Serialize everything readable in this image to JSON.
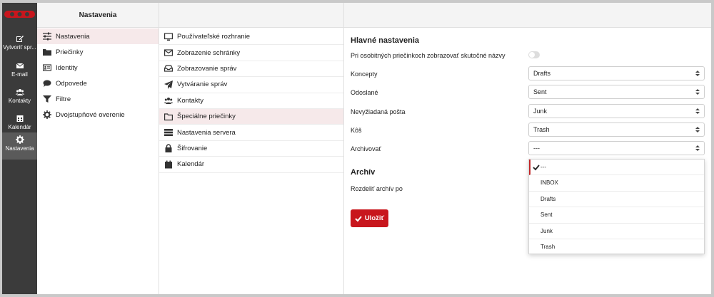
{
  "rail": {
    "items": [
      {
        "label": "Vytvoriť spr...",
        "icon": "compose-icon"
      },
      {
        "label": "E-mail",
        "icon": "mail-icon"
      },
      {
        "label": "Kontakty",
        "icon": "contacts-icon"
      },
      {
        "label": "Kalendár",
        "icon": "calendar-icon"
      },
      {
        "label": "Nastavenia",
        "icon": "gear-icon"
      }
    ]
  },
  "col1": {
    "title": "Nastavenia",
    "items": [
      {
        "label": "Nastavenia",
        "icon": "sliders-icon"
      },
      {
        "label": "Priečinky",
        "icon": "folder-icon"
      },
      {
        "label": "Identity",
        "icon": "id-card-icon"
      },
      {
        "label": "Odpovede",
        "icon": "comment-icon"
      },
      {
        "label": "Filtre",
        "icon": "filter-icon"
      },
      {
        "label": "Dvojstupňové overenie",
        "icon": "gear-icon"
      }
    ]
  },
  "col2": {
    "items": [
      {
        "label": "Používateľské rozhranie",
        "icon": "monitor-icon"
      },
      {
        "label": "Zobrazenie schránky",
        "icon": "envelope-icon"
      },
      {
        "label": "Zobrazovanie správ",
        "icon": "inbox-icon"
      },
      {
        "label": "Vytváranie správ",
        "icon": "paper-plane-icon"
      },
      {
        "label": "Kontakty",
        "icon": "users-icon"
      },
      {
        "label": "Špeciálne priečinky",
        "icon": "folder-open-icon"
      },
      {
        "label": "Nastavenia servera",
        "icon": "server-icon"
      },
      {
        "label": "Šifrovanie",
        "icon": "lock-icon"
      },
      {
        "label": "Kalendár",
        "icon": "calendar-icon"
      }
    ]
  },
  "main": {
    "section1_title": "Hlavné nastavenia",
    "toggle_label": "Pri osobitných priečinkoch zobrazovať skutočné názvy",
    "rows": [
      {
        "label": "Koncepty",
        "value": "Drafts"
      },
      {
        "label": "Odoslané",
        "value": "Sent"
      },
      {
        "label": "Nevyžiadaná pošta",
        "value": "Junk"
      },
      {
        "label": "Kôš",
        "value": "Trash"
      },
      {
        "label": "Archivovať",
        "value": "---"
      }
    ],
    "section2_title": "Archív",
    "split_label": "Rozdeliť archív po",
    "dropdown_options": [
      "---",
      "INBOX",
      "Drafts",
      "Sent",
      "Junk",
      "Trash"
    ],
    "save_label": "Uložiť"
  },
  "colors": {
    "accent": "#c8161d",
    "rail_bg": "#3b3b3b",
    "active_row": "#f6e9ea"
  }
}
